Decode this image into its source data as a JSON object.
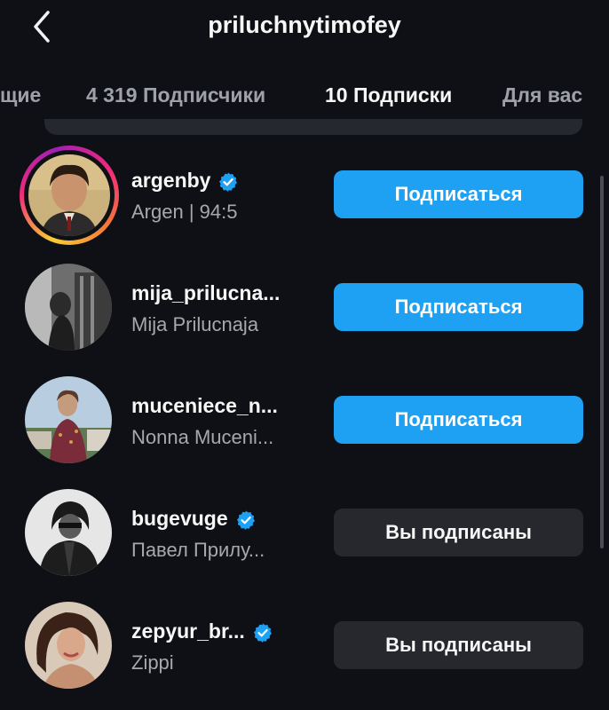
{
  "header": {
    "title": "priluchnytimofey",
    "back_icon": "chevron-left-icon"
  },
  "tabs": [
    {
      "label": "щие"
    },
    {
      "label": "4 319 Подписчики"
    },
    {
      "label": "10 Подписки",
      "active": true
    },
    {
      "label": "Для вас"
    }
  ],
  "accounts": [
    {
      "username": "argenby",
      "full_name": "Argen | 94:5",
      "verified": true,
      "has_story": true,
      "button": "Подписаться",
      "state": "follow"
    },
    {
      "username": "mija_prilucna...",
      "full_name": "Mija Prilucnaja",
      "verified": false,
      "has_story": false,
      "button": "Подписаться",
      "state": "follow"
    },
    {
      "username": "muceniece_n...",
      "full_name": "Nonna Muceni...",
      "verified": false,
      "has_story": false,
      "button": "Подписаться",
      "state": "follow"
    },
    {
      "username": "bugevuge",
      "full_name": "Павел Прилу...",
      "verified": true,
      "has_story": false,
      "button": "Вы подписаны",
      "state": "following"
    },
    {
      "username": "zepyur_br...",
      "full_name": "Zippi",
      "verified": true,
      "has_story": false,
      "button": "Вы подписаны",
      "state": "following"
    }
  ],
  "colors": {
    "background": "#0e1015",
    "follow_button": "#1ea1f2",
    "following_button": "#26282e",
    "verified_badge": "#1ea1f2"
  }
}
